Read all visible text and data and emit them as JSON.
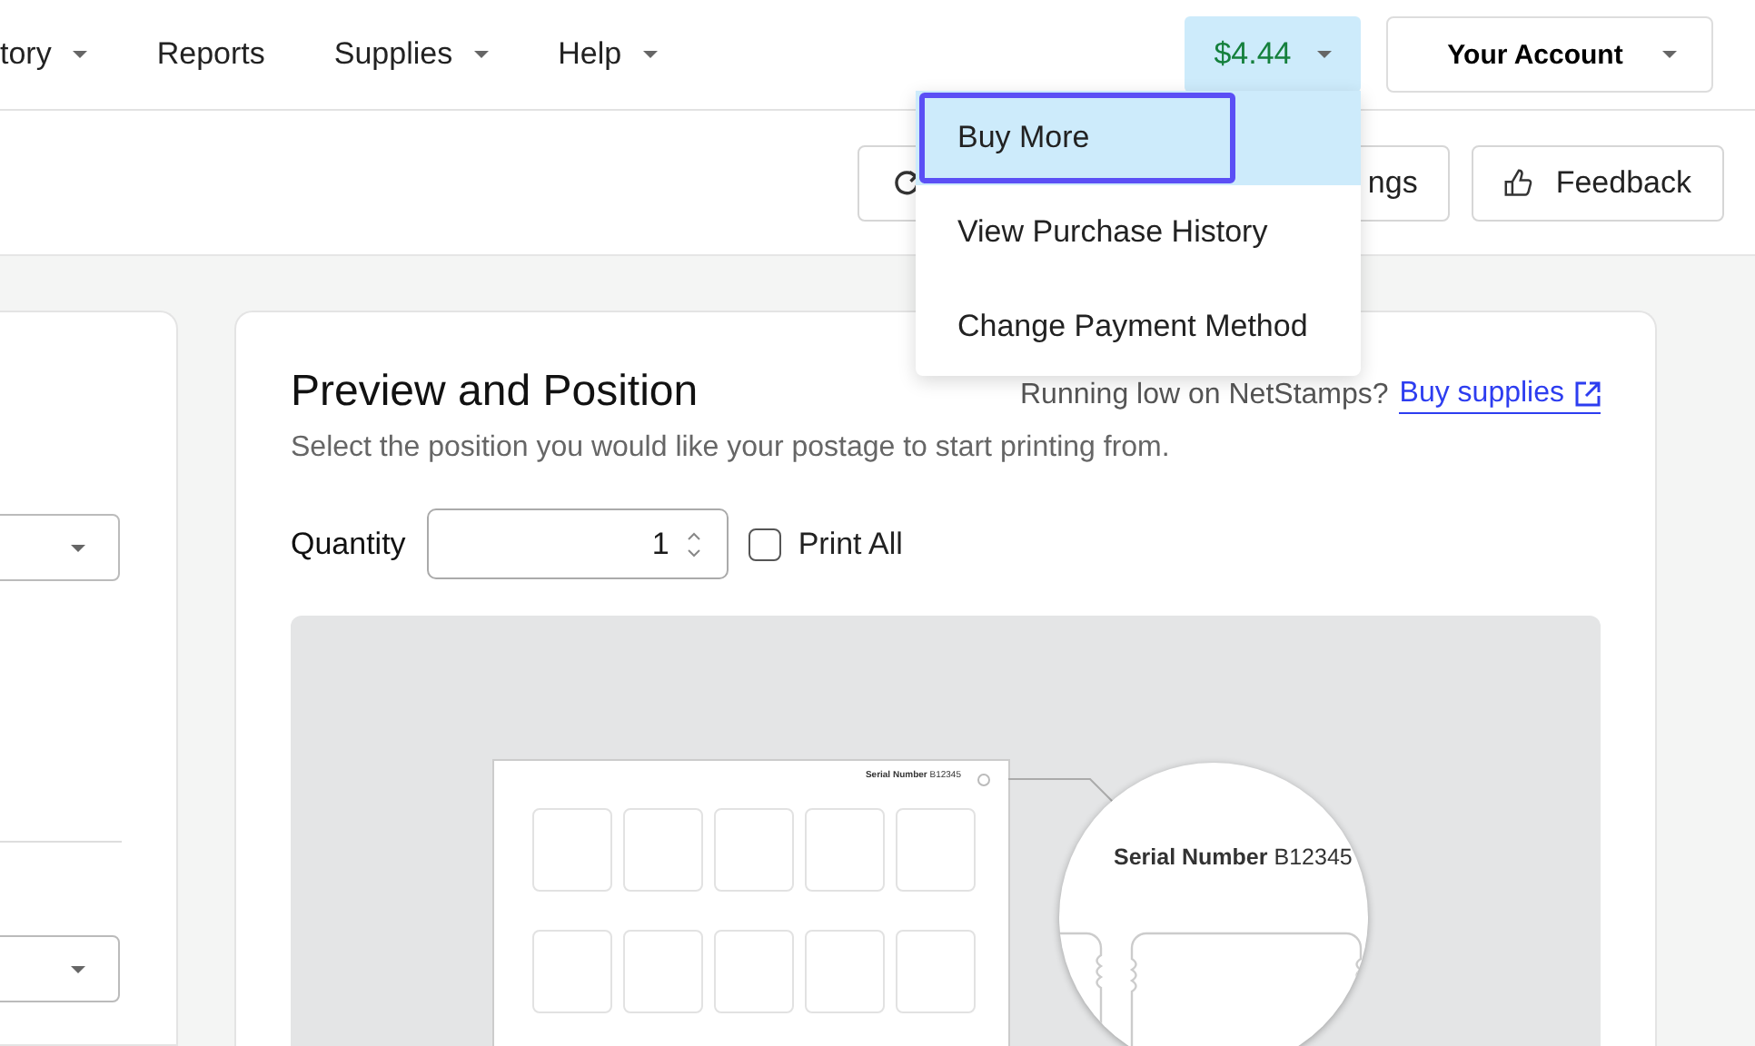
{
  "nav": {
    "items": [
      {
        "label": "tory",
        "dropdown": true
      },
      {
        "label": "Reports",
        "dropdown": false
      },
      {
        "label": "Supplies",
        "dropdown": true
      },
      {
        "label": "Help",
        "dropdown": true
      }
    ]
  },
  "balance": {
    "amount": "$4.44",
    "open": true
  },
  "account": {
    "label": "Your Account"
  },
  "toolbar": {
    "buttons": [
      {
        "kind": "refresh",
        "label": "ngs"
      },
      {
        "kind": "feedback",
        "label": "Feedback"
      }
    ]
  },
  "balance_menu": {
    "items": [
      {
        "label": "Buy More",
        "selected": true
      },
      {
        "label": "View Purchase History",
        "selected": false
      },
      {
        "label": "Change Payment Method",
        "selected": false
      }
    ]
  },
  "preview": {
    "title": "Preview and Position",
    "low_supplies_text": "Running low on NetStamps?",
    "buy_link": "Buy supplies",
    "subtitle": "Select the position you would like your postage to start printing from.",
    "quantity": {
      "label": "Quantity",
      "value": "1"
    },
    "print_all": {
      "label": "Print All",
      "checked": false
    },
    "sheet": {
      "serial_label": "Serial Number",
      "serial_value": "B12345"
    },
    "magnifier": {
      "serial_label": "Serial Number",
      "serial_value": "B12345"
    }
  }
}
